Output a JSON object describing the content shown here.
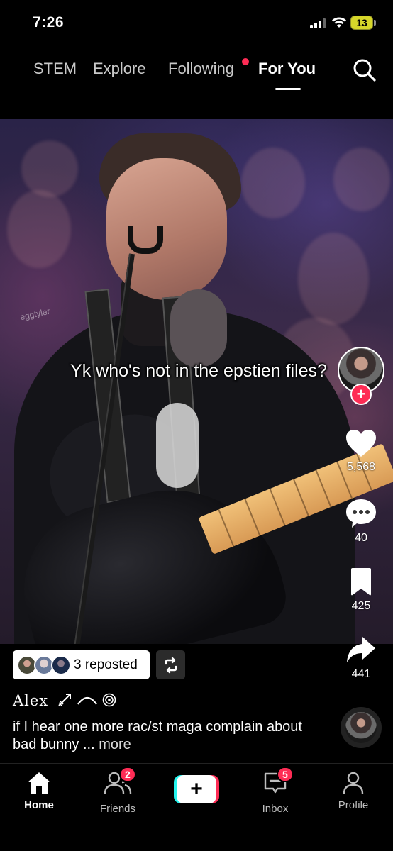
{
  "status_bar": {
    "time": "7:26",
    "battery": "13",
    "battery_color": "#d6d62a"
  },
  "top_nav": {
    "tabs": [
      {
        "label": "STEM",
        "active": false
      },
      {
        "label": "Explore",
        "active": false
      },
      {
        "label": "Following",
        "active": false,
        "has_dot": true
      },
      {
        "label": "For You",
        "active": true
      }
    ],
    "search_icon": "search-icon"
  },
  "video": {
    "caption": "Yk who's not in the epstien files?",
    "watermark": "eggtyler"
  },
  "right_rail": {
    "follow_icon": "plus-icon",
    "like_count": "5,568",
    "comment_count": "40",
    "save_count": "425",
    "share_count": "441"
  },
  "post": {
    "repost_text": "3 reposted",
    "username": "Alex",
    "description": "if I hear one more rac/st maga complain about bad bunny ...",
    "more_label": "more"
  },
  "tab_bar": {
    "home": "Home",
    "friends": "Friends",
    "friends_badge": "2",
    "create": "+",
    "inbox": "Inbox",
    "inbox_badge": "5",
    "profile": "Profile"
  },
  "colors": {
    "accent": "#fe2c55",
    "cyan": "#25f4ee"
  }
}
